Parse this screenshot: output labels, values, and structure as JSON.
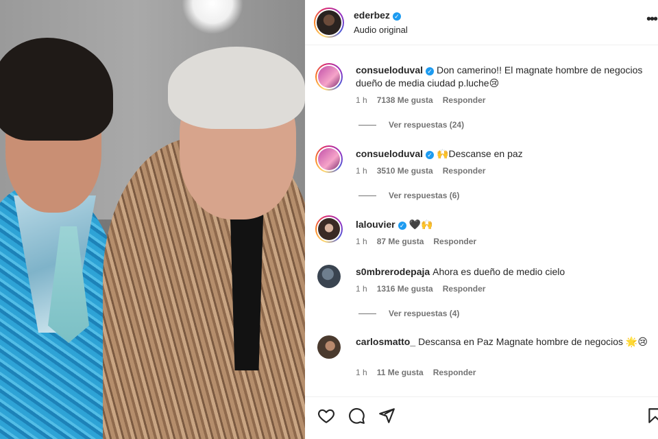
{
  "post": {
    "username": "ederbez",
    "verified": true,
    "audio": "Audio original"
  },
  "comments": [
    {
      "username": "consueloduval",
      "verified": true,
      "text": "Don camerino!! El magnate hombre de negocios dueño de media ciudad p.luche😢",
      "time": "1 h",
      "likes": "7138 Me gusta",
      "reply": "Responder",
      "view_replies": "Ver respuestas (24)"
    },
    {
      "username": "consueloduval",
      "verified": true,
      "text": "🙌Descanse en paz",
      "time": "1 h",
      "likes": "3510 Me gusta",
      "reply": "Responder",
      "view_replies": "Ver respuestas (6)"
    },
    {
      "username": "lalouvier",
      "verified": true,
      "text": "🖤🙌",
      "time": "1 h",
      "likes": "87 Me gusta",
      "reply": "Responder"
    },
    {
      "username": "s0mbrerodepaja",
      "verified": false,
      "text": "Ahora es dueño de medio cielo",
      "time": "1 h",
      "likes": "1316 Me gusta",
      "reply": "Responder",
      "view_replies": "Ver respuestas (4)"
    },
    {
      "username": "carlosmatto_",
      "verified": false,
      "text": "Descansa en Paz Magnate hombre de negocios 🌟😢",
      "time": "1 h",
      "likes": "11 Me gusta",
      "reply": "Responder"
    }
  ],
  "actions": {
    "like_icon": "heart-icon",
    "comment_icon": "comment-icon",
    "share_icon": "send-icon",
    "save_icon": "bookmark-icon"
  },
  "colors": {
    "verified": "#1d9bf0",
    "meta_text": "#737373",
    "text": "#262626"
  }
}
